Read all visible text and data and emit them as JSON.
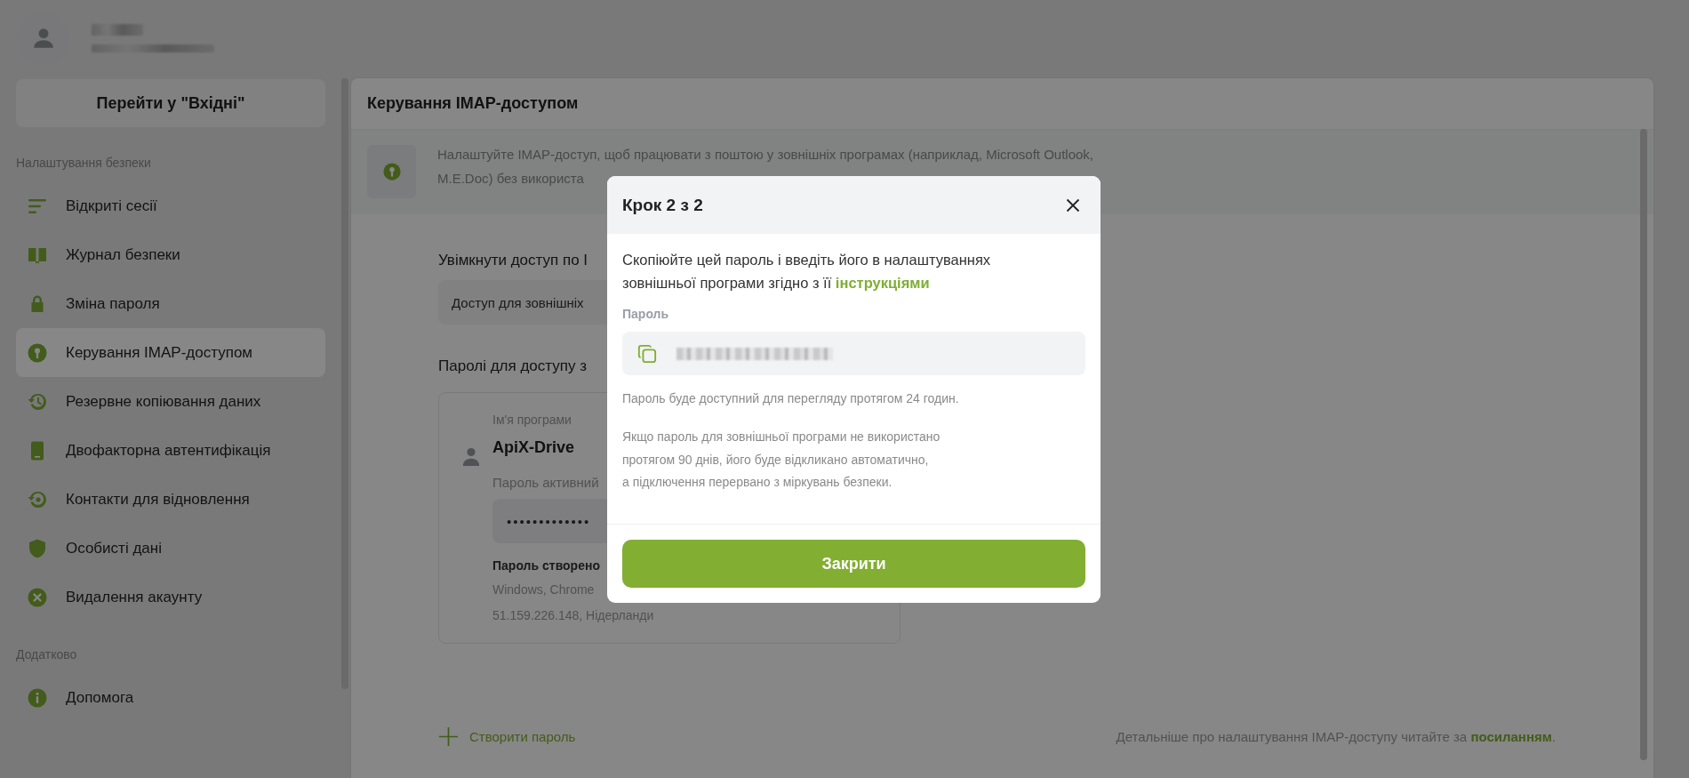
{
  "sidebar": {
    "inbox_button": "Перейти у \"Вхідні\"",
    "sections": [
      {
        "heading": "Налаштування безпеки",
        "items": [
          {
            "label": "Відкриті сесії",
            "selected": false
          },
          {
            "label": "Журнал безпеки",
            "selected": false
          },
          {
            "label": "Зміна пароля",
            "selected": false
          },
          {
            "label": "Керування IMAP-доступом",
            "selected": true
          },
          {
            "label": "Резервне копіювання даних",
            "selected": false
          },
          {
            "label": "Двофакторна автентифікація",
            "selected": false
          },
          {
            "label": "Контакти для відновлення",
            "selected": false
          },
          {
            "label": "Особисті дані",
            "selected": false
          },
          {
            "label": "Видалення акаунту",
            "selected": false
          }
        ]
      },
      {
        "heading": "Додатково",
        "items": [
          {
            "label": "Допомога",
            "selected": false
          }
        ]
      }
    ]
  },
  "main": {
    "title": "Керування IMAP-доступом",
    "info_lines": [
      "Налаштуйте IMAP-доступ, щоб працювати з поштою у зовнішніх програмах (наприклад, Microsoft Outlook,",
      "M.E.Doc) без використа"
    ],
    "imap_toggle": {
      "label": "Увімкнути доступ по I",
      "value": "Доступ для зовнішніх"
    },
    "passwords_heading": "Паролі для доступу з",
    "password_card": {
      "name_label": "Ім'я програми",
      "name": "ApiX-Drive",
      "status": "Пароль активний",
      "password_mask": "•••••••••••••",
      "created_label": "Пароль створено",
      "device": "Windows, Chrome",
      "location": "51.159.226.148, Нідерланди"
    },
    "create_button": "Створити пароль",
    "footer_note": {
      "text": "Детальніше про налаштування IMAP-доступу читайте за",
      "link": "посиланням",
      "end": "."
    }
  },
  "modal": {
    "title": "Крок 2 з 2",
    "instruction": "Скопіюйте цей пароль і введіть його в налаштуваннях зовнішньої програми згідно з її",
    "instruction_link": "інструкціями",
    "password_label": "Пароль",
    "availability_note": "Пароль буде доступний для перегляду протягом 24 годин.",
    "expiry_lines": [
      "Якщо пароль для зовнішньої програми не використано",
      "протягом 90 днів, його буде відкликано автоматично,",
      "а підключення перервано з міркувань безпеки."
    ],
    "close_button": "Закрити"
  }
}
